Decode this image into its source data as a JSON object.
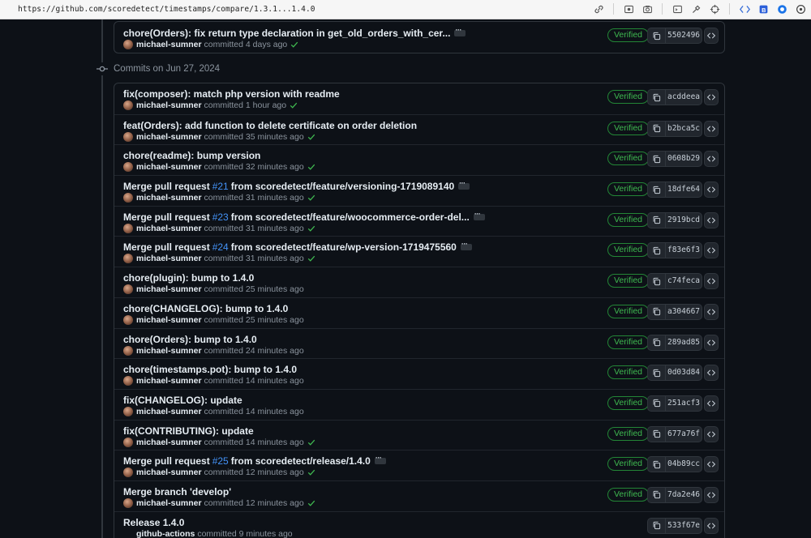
{
  "browser": {
    "url": "https://github.com/scoredetect/timestamps/compare/1.3.1...1.4.0"
  },
  "top_commit": {
    "message": "chore(Orders): fix return type declaration in get_old_orders_with_cer...",
    "author": "michael-sumner",
    "time": "committed 4 days ago",
    "verified": "Verified",
    "sha": "5502496"
  },
  "group": {
    "label": "Commits on Jun 27, 2024"
  },
  "commits": [
    {
      "pre": "fix(composer): match php version with readme",
      "pr": "",
      "post": "",
      "ellipsis": false,
      "author": "michael-sumner",
      "time": "committed 1 hour ago",
      "check": true,
      "verified": "Verified",
      "sha": "acddeea",
      "avatar": true
    },
    {
      "pre": "feat(Orders): add function to delete certificate on order deletion",
      "pr": "",
      "post": "",
      "ellipsis": false,
      "author": "michael-sumner",
      "time": "committed 35 minutes ago",
      "check": true,
      "verified": "Verified",
      "sha": "b2bca5c",
      "avatar": true
    },
    {
      "pre": "chore(readme): bump version",
      "pr": "",
      "post": "",
      "ellipsis": false,
      "author": "michael-sumner",
      "time": "committed 32 minutes ago",
      "check": true,
      "verified": "Verified",
      "sha": "0608b29",
      "avatar": true
    },
    {
      "pre": "Merge pull request",
      "pr": "#21",
      "post": "from scoredetect/feature/versioning-1719089140",
      "ellipsis": true,
      "author": "michael-sumner",
      "time": "committed 31 minutes ago",
      "check": true,
      "verified": "Verified",
      "sha": "18dfe64",
      "avatar": true
    },
    {
      "pre": "Merge pull request",
      "pr": "#23",
      "post": "from scoredetect/feature/woocommerce-order-del...",
      "ellipsis": true,
      "author": "michael-sumner",
      "time": "committed 31 minutes ago",
      "check": true,
      "verified": "Verified",
      "sha": "2919bcd",
      "avatar": true
    },
    {
      "pre": "Merge pull request",
      "pr": "#24",
      "post": "from scoredetect/feature/wp-version-1719475560",
      "ellipsis": true,
      "author": "michael-sumner",
      "time": "committed 31 minutes ago",
      "check": true,
      "verified": "Verified",
      "sha": "f83e6f3",
      "avatar": true
    },
    {
      "pre": "chore(plugin): bump to 1.4.0",
      "pr": "",
      "post": "",
      "ellipsis": false,
      "author": "michael-sumner",
      "time": "committed 25 minutes ago",
      "check": false,
      "verified": "Verified",
      "sha": "c74feca",
      "avatar": true
    },
    {
      "pre": "chore(CHANGELOG): bump to 1.4.0",
      "pr": "",
      "post": "",
      "ellipsis": false,
      "author": "michael-sumner",
      "time": "committed 25 minutes ago",
      "check": false,
      "verified": "Verified",
      "sha": "a304667",
      "avatar": true
    },
    {
      "pre": "chore(Orders): bump to 1.4.0",
      "pr": "",
      "post": "",
      "ellipsis": false,
      "author": "michael-sumner",
      "time": "committed 24 minutes ago",
      "check": false,
      "verified": "Verified",
      "sha": "289ad85",
      "avatar": true
    },
    {
      "pre": "chore(timestamps.pot): bump to 1.4.0",
      "pr": "",
      "post": "",
      "ellipsis": false,
      "author": "michael-sumner",
      "time": "committed 14 minutes ago",
      "check": false,
      "verified": "Verified",
      "sha": "0d03d84",
      "avatar": true
    },
    {
      "pre": "fix(CHANGELOG): update",
      "pr": "",
      "post": "",
      "ellipsis": false,
      "author": "michael-sumner",
      "time": "committed 14 minutes ago",
      "check": false,
      "verified": "Verified",
      "sha": "251acf3",
      "avatar": true
    },
    {
      "pre": "fix(CONTRIBUTING): update",
      "pr": "",
      "post": "",
      "ellipsis": false,
      "author": "michael-sumner",
      "time": "committed 14 minutes ago",
      "check": true,
      "verified": "Verified",
      "sha": "677a76f",
      "avatar": true
    },
    {
      "pre": "Merge pull request",
      "pr": "#25",
      "post": "from scoredetect/release/1.4.0",
      "ellipsis": true,
      "author": "michael-sumner",
      "time": "committed 12 minutes ago",
      "check": true,
      "verified": "Verified",
      "sha": "04b89cc",
      "avatar": true
    },
    {
      "pre": "Merge branch 'develop'",
      "pr": "",
      "post": "",
      "ellipsis": false,
      "author": "michael-sumner",
      "time": "committed 12 minutes ago",
      "check": true,
      "verified": "Verified",
      "sha": "7da2e46",
      "avatar": true
    },
    {
      "pre": "Release 1.4.0",
      "pr": "",
      "post": "",
      "ellipsis": false,
      "author": "github-actions",
      "time": "committed 9 minutes ago",
      "check": false,
      "verified": "",
      "sha": "533f67e",
      "avatar": false
    }
  ]
}
